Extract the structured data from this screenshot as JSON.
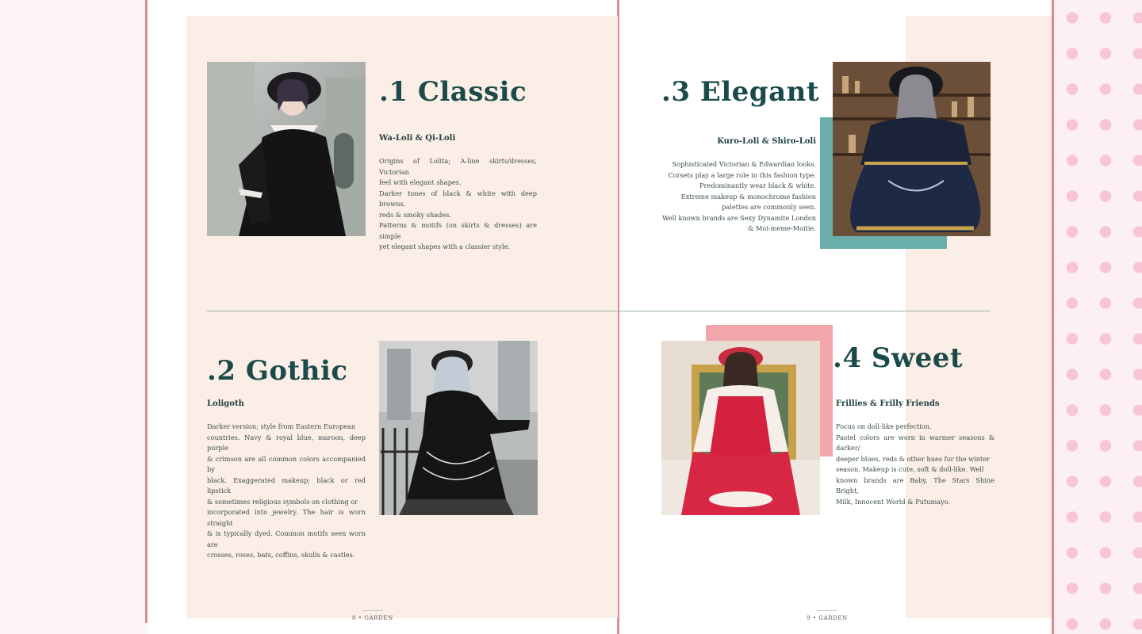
{
  "sections": {
    "classic": {
      "title": ".1 Classic",
      "subtitle": "Wa-Loli & Qi-Loli",
      "lines": [
        "Origins of Lolita; A-line skirts/dresses, Victorian",
        "feel with elegant shapes.",
        "Darker tones of black & white with deep browns,",
        "reds & smoky shades.",
        "Patterns & motifs (on skirts & dresses) are simple",
        "yet elegant shapes with a classier style."
      ]
    },
    "gothic": {
      "title": ".2 Gothic",
      "subtitle": "Loligoth",
      "lines": [
        "Darker version; style from Eastern European",
        "countries. Navy & royal blue, maroon, deep purple",
        "& crimson are all common colors accompanied by",
        "black. Exaggerated makeup; black or red lipstick",
        "& sometimes religious symbols on clothing or",
        "incorporated into jewelry. The hair is worn straight",
        "& is typically dyed. Common motifs seen worn are",
        "crosses, roses, bats, coffins, skulls & castles."
      ]
    },
    "elegant": {
      "title": ".3 Elegant",
      "subtitle": "Kuro-Loli & Shiro-Loli",
      "lines": [
        "Sophisticated Victorian & Edwardian looks.",
        "Corsets play a large role in this fashion type.",
        "Predominantly wear black & white.",
        "Extreme makeup & monochrome fashion",
        "palettes are commonly seen.",
        "Well known brands are Sexy Dynamite London",
        "& Moi-meme-Moitie."
      ]
    },
    "sweet": {
      "title": ".4 Sweet",
      "subtitle": "Frillies & Frilly Friends",
      "lines": [
        "Focus on doll-like perfection.",
        "Pastel colors are worn in warmer seasons & darker/",
        "deeper blues, reds & other hues for the winter",
        "season. Makeup is cute, soft & doll-like. Well",
        "known brands are Baby, The Stars Shine Bright,",
        "Milk, Innocent World & Putumayo."
      ]
    }
  },
  "footer": {
    "left": "8  •  GARDEN",
    "right": "9  •  GARDEN"
  },
  "colors": {
    "heading": "#1b4a4a",
    "panel": "#fbeee6",
    "accent_teal": "#6aaea9",
    "accent_pink": "#f2a5ab",
    "spine": "#d98c91",
    "dots": "#f7c5d7"
  },
  "images": {
    "classic": "photo-woman-black-velvet-dress-beret",
    "gothic": "photo-woman-gothic-black-dress-steps",
    "elegant": "photo-woman-navy-gold-dress-bonnet",
    "sweet": "photo-girl-red-white-sweet-dress"
  }
}
